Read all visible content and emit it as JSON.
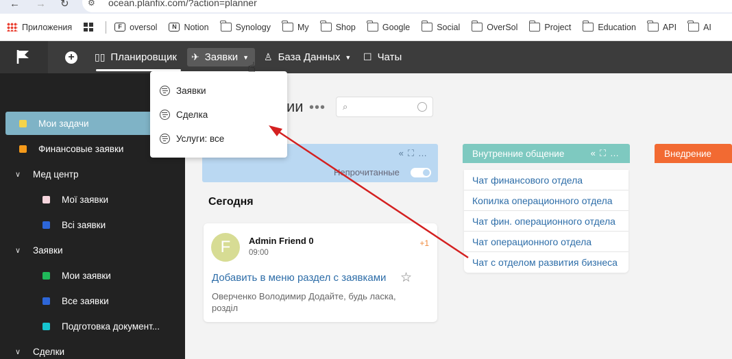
{
  "browser": {
    "address": "ocean.planfix.com/?action=planner",
    "bookmarks": [
      "Приложения",
      "oversol",
      "Notion",
      "Synology",
      "My",
      "Shop",
      "Google",
      "Social",
      "OverSol",
      "Project",
      "Education",
      "API",
      "AI"
    ]
  },
  "header": {
    "planner": "Планировщик",
    "requests": "Заявки",
    "database": "База Данных",
    "chats": "Чаты"
  },
  "dropdown": {
    "items": [
      "Заявки",
      "Сделка",
      "Услуги: все"
    ]
  },
  "sidebar": {
    "items": [
      {
        "label": "Мои задачи",
        "color": "#f5d44a"
      },
      {
        "label": "Финансовые заявки",
        "color": "#f59a1a"
      },
      {
        "label": "Мед центр"
      },
      {
        "label": "Мої заявки",
        "color": "#f6d5dd"
      },
      {
        "label": "Всі заявки",
        "color": "#2d66d8"
      },
      {
        "label": "Заявки"
      },
      {
        "label": "Мои заявки",
        "color": "#20b85a"
      },
      {
        "label": "Все заявки",
        "color": "#2d66d8"
      },
      {
        "label": "Подготовка документ...",
        "color": "#16c4cf"
      },
      {
        "label": "Сделки"
      }
    ]
  },
  "main": {
    "title_fragment": "ии",
    "unread_label": "Непрочитанные",
    "today": "Сегодня",
    "columns": {
      "internal": "Внутренние общение",
      "implementation": "Внедрение"
    },
    "chats": [
      "Чат финансового отдела",
      "Копилка операционного отдела",
      "Чат фин. операционного отдела",
      "Чат операционного отдела",
      "Чат с отделом развития бизнеса"
    ],
    "card": {
      "avatar_letter": "F",
      "author": "Admin Friend 0",
      "time": "09:00",
      "badge": "+1",
      "title": "Добавить в меню раздел с заявками",
      "body": "Оверченко Володимир Додайте, будь ласка, розділ"
    }
  }
}
